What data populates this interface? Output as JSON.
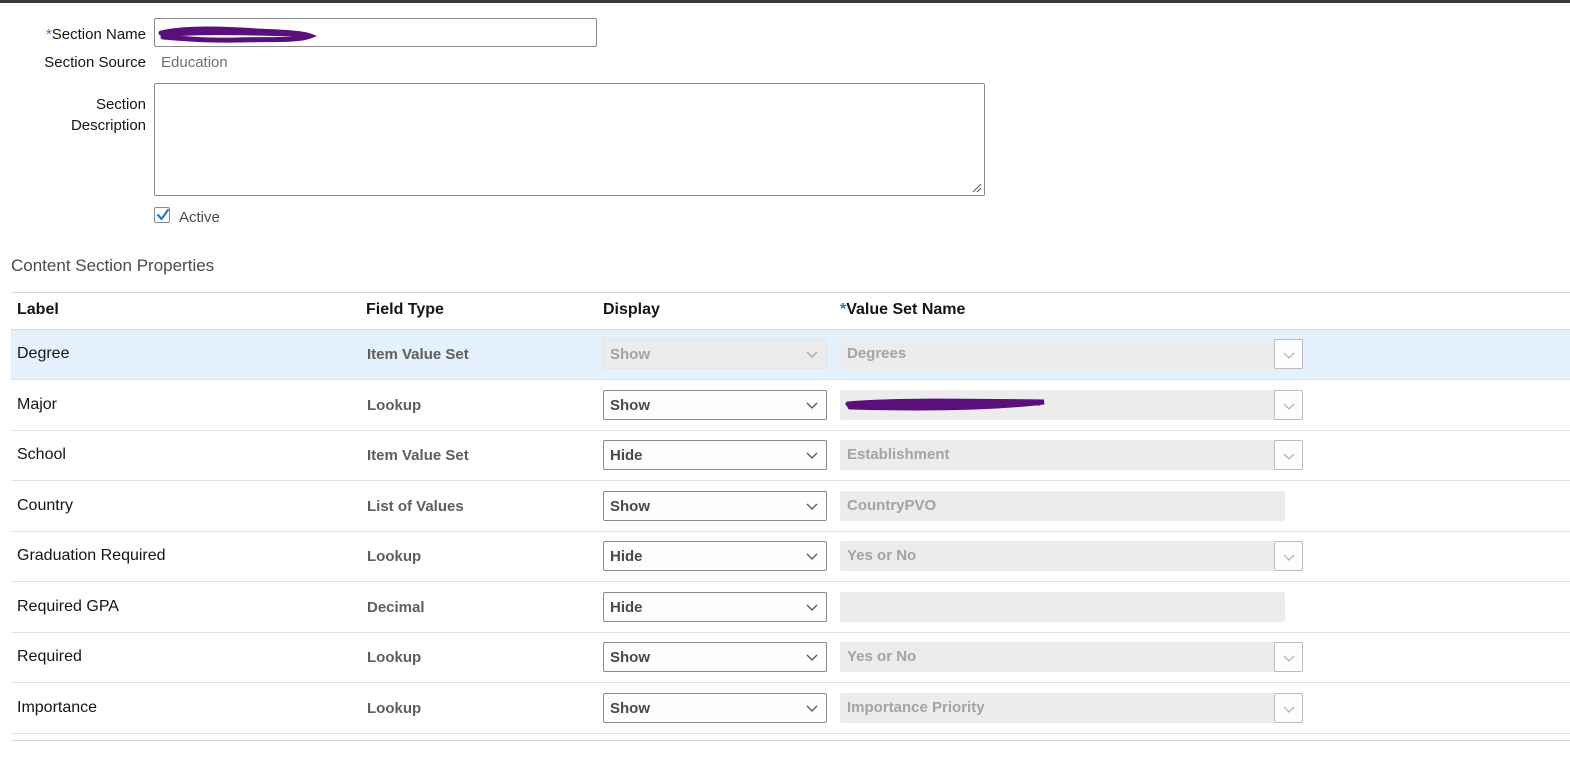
{
  "form": {
    "section_name_label": "Section Name",
    "required_marker": "*",
    "section_name_value": "",
    "section_source_label": "Section Source",
    "section_source_value": "Education",
    "section_description_label_1": "Section",
    "section_description_label_2": "Description",
    "section_description_value": "",
    "active_label": "Active",
    "active_checked": true
  },
  "content": {
    "title": "Content Section Properties",
    "columns": {
      "label": "Label",
      "field_type": "Field Type",
      "display": "Display",
      "value_set_name": "Value Set Name"
    },
    "rows": [
      {
        "label": "Degree",
        "field_type": "Item Value Set",
        "display": "Show",
        "display_disabled": true,
        "value_set": "Degrees",
        "has_button": true,
        "selected": true
      },
      {
        "label": "Major",
        "field_type": "Lookup",
        "display": "Show",
        "display_disabled": false,
        "value_set": "",
        "has_button": true,
        "selected": false
      },
      {
        "label": "School",
        "field_type": "Item Value Set",
        "display": "Hide",
        "display_disabled": false,
        "value_set": "Establishment",
        "has_button": true,
        "selected": false
      },
      {
        "label": "Country",
        "field_type": "List of Values",
        "display": "Show",
        "display_disabled": false,
        "value_set": "CountryPVO",
        "has_button": false,
        "selected": false
      },
      {
        "label": "Graduation Required",
        "field_type": "Lookup",
        "display": "Hide",
        "display_disabled": false,
        "value_set": "Yes or No",
        "has_button": true,
        "selected": false
      },
      {
        "label": "Required GPA",
        "field_type": "Decimal",
        "display": "Hide",
        "display_disabled": false,
        "value_set": "",
        "has_button": false,
        "selected": false
      },
      {
        "label": "Required",
        "field_type": "Lookup",
        "display": "Show",
        "display_disabled": false,
        "value_set": "Yes or No",
        "has_button": true,
        "selected": false
      },
      {
        "label": "Importance",
        "field_type": "Lookup",
        "display": "Show",
        "display_disabled": false,
        "value_set": "Importance Priority",
        "has_button": true,
        "selected": false
      }
    ]
  },
  "icons": {
    "checkbox": "checkmark-icon",
    "select": "chevron-down-icon",
    "resize": "resize-grip-icon"
  },
  "colors": {
    "required_marker": "#227ac9",
    "selected_row": "#e4f0fb",
    "checkbox_check": "#227ac9",
    "redaction": "#5b0f7a"
  }
}
